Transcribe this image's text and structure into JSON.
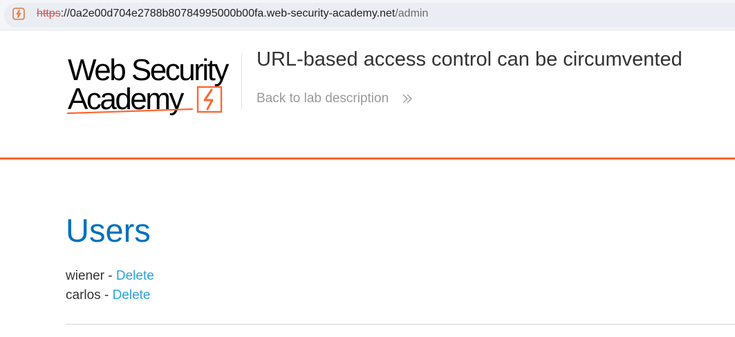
{
  "browser": {
    "url_scheme": "https",
    "url_rest": "://0a2e00d704e2788b80784995000b00fa.web-security-academy.net",
    "url_path": "/admin",
    "security_icon": "not-secure-icon"
  },
  "header": {
    "logo_line1": "Web Security",
    "logo_line2": "Academy",
    "lab_title": "URL-based access control can be circumvented",
    "back_link": "Back to lab description",
    "back_icon": "double-chevron-right-icon"
  },
  "colors": {
    "accent_orange": "#ff6633",
    "heading_blue": "#0071bc",
    "link_blue": "#29a3dc",
    "text_dark": "#333333",
    "text_muted": "#999999"
  },
  "main": {
    "heading": "Users",
    "users": [
      {
        "name": "wiener",
        "separator": " - ",
        "action": "Delete"
      },
      {
        "name": "carlos",
        "separator": " - ",
        "action": "Delete"
      }
    ]
  }
}
